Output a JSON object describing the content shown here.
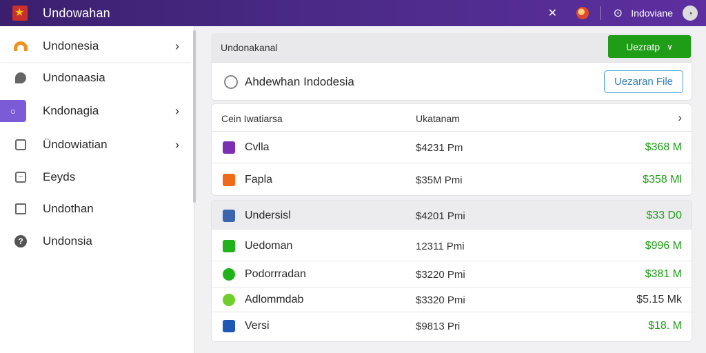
{
  "header": {
    "app_title": "Undowahan",
    "language": "Indoviane",
    "icons": [
      "pin-icon",
      "flag-icon",
      "location-icon",
      "globe-icon"
    ]
  },
  "sidebar": {
    "items": [
      {
        "label": "Undonesia",
        "icon": "wifi-icon",
        "has_chevron": true,
        "active": true
      },
      {
        "label": "Undonaasia",
        "icon": "pin-icon",
        "has_chevron": false
      },
      {
        "label": "Kndonagia",
        "icon": "chat-icon",
        "has_chevron": true
      },
      {
        "label": "Ündowiatian",
        "icon": "checkbox-icon",
        "has_chevron": true
      },
      {
        "label": "Eeyds",
        "icon": "minus-box-icon",
        "has_chevron": false
      },
      {
        "label": "Undothan",
        "icon": "calendar-icon",
        "has_chevron": false
      },
      {
        "label": "Undonsia",
        "icon": "help-icon",
        "has_chevron": false
      }
    ]
  },
  "panel": {
    "title": "Undonakanal",
    "action_label": "Uezratp",
    "file_label": "Ahdewhan Indodesia",
    "upload_label": "Uezaran File"
  },
  "table": {
    "col1": "Cein Iwatiarsa",
    "col2": "Ukatanam",
    "rows_a": [
      {
        "name": "Cvlla",
        "amount": "$4231 Pm",
        "value": "$368 M",
        "icon_color": "#7b2fb3"
      },
      {
        "name": "Fapla",
        "amount": "$35M Pmi",
        "value": "$358 Ml",
        "icon_color": "#ef6b1a"
      }
    ],
    "rows_b": [
      {
        "name": "Undersisl",
        "amount": "$4201 Pmi",
        "value": "$33 D0",
        "icon_color": "#3a66b0"
      },
      {
        "name": "Uedoman",
        "amount": "12311 Pmi",
        "value": "$996 M",
        "icon_color": "#1fb319"
      },
      {
        "name": "Podorrradan",
        "amount": "$3220 Pmi",
        "value": "$381 M",
        "icon_color": "#1fb319"
      },
      {
        "name": "Adlommdab",
        "amount": "$3320 Pmi",
        "value": "$5.15 Mk",
        "icon_color": "#6fcf2a"
      },
      {
        "name": "Versi",
        "amount": "$9813 Pri",
        "value": "$18. M",
        "icon_color": "#1e57b5"
      }
    ]
  },
  "colors": {
    "accent_green": "#1f9d17",
    "header_purple": "#4a2a86",
    "outline_blue": "#4a9fd0"
  }
}
